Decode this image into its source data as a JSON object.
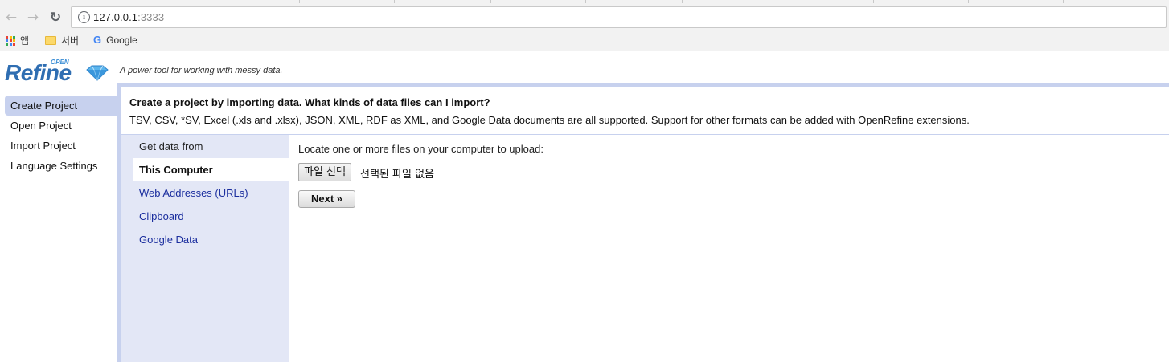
{
  "browser": {
    "url_host": "127.0.0.1",
    "url_port": ":3333",
    "bookmarks": [
      {
        "label": "앱",
        "icon": "apps-grid-icon"
      },
      {
        "label": "서버",
        "icon": "folder-icon"
      },
      {
        "label": "Google",
        "icon": "google-icon"
      }
    ]
  },
  "app": {
    "logo_text": "Refine",
    "logo_small": "OPEN",
    "tagline": "A power tool for working with messy data."
  },
  "nav": {
    "items": [
      {
        "label": "Create Project"
      },
      {
        "label": "Open Project"
      },
      {
        "label": "Import Project"
      },
      {
        "label": "Language Settings"
      }
    ],
    "selected": "Create Project"
  },
  "panel": {
    "title": "Create a project by importing data. What kinds of data files can I import?",
    "description": "TSV, CSV, *SV, Excel (.xls and .xlsx), JSON, XML, RDF as XML, and Google Data documents are all supported. Support for other formats can be added with OpenRefine extensions."
  },
  "sources": {
    "heading": "Get data from",
    "items": [
      {
        "label": "This Computer"
      },
      {
        "label": "Web Addresses (URLs)"
      },
      {
        "label": "Clipboard"
      },
      {
        "label": "Google Data"
      }
    ],
    "active": "This Computer"
  },
  "upload": {
    "label": "Locate one or more files on your computer to upload:",
    "choose_button": "파일 선택",
    "file_status": "선택된 파일 없음",
    "next_button": "Next »"
  },
  "colors": {
    "accent_light": "#c7d1ee",
    "sources_bg": "#e3e7f6",
    "link": "#1b2e9e",
    "logo_blue": "#2f6eb2"
  }
}
